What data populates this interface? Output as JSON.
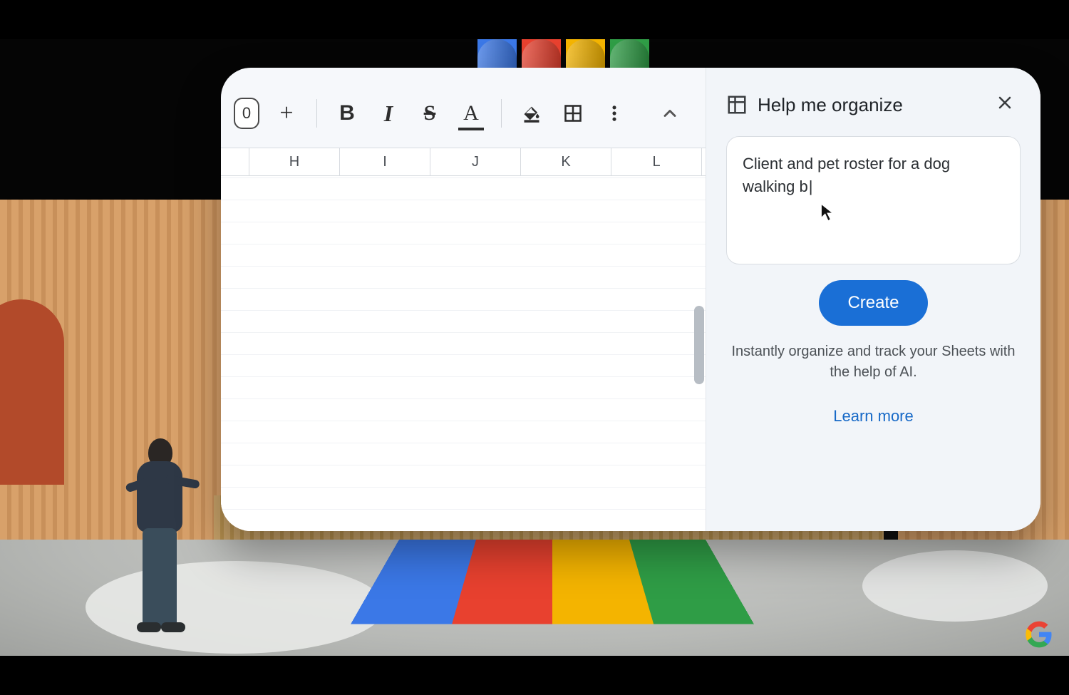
{
  "toolbar": {
    "pill_value": "0",
    "plus_label": "+",
    "bold": "B",
    "italic": "I",
    "strike": "S",
    "textcolor": "A"
  },
  "columns": [
    "H",
    "I",
    "J",
    "K",
    "L"
  ],
  "side_panel": {
    "title": "Help me organize",
    "prompt_text": "Client and pet roster for a dog walking b",
    "create_label": "Create",
    "help_text": "Instantly organize and track your Sheets with the help of AI.",
    "learn_more": "Learn more"
  }
}
